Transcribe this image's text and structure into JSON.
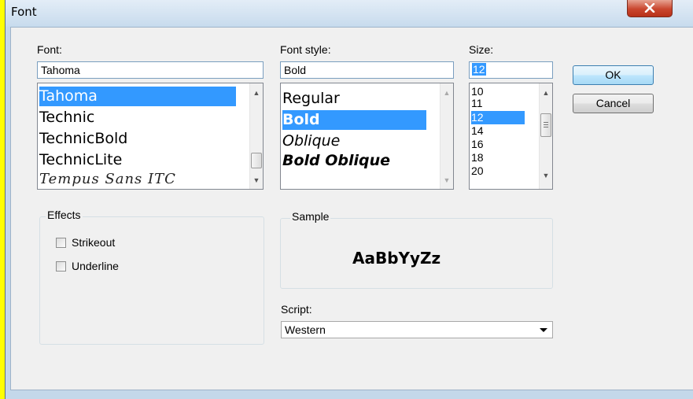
{
  "window": {
    "title": "Font"
  },
  "labels": {
    "font": "Font:",
    "font_style": "Font style:",
    "size": "Size:",
    "script": "Script:"
  },
  "inputs": {
    "font_value": "Tahoma",
    "style_value": "Bold",
    "size_value": "12"
  },
  "font_list": {
    "items": [
      "Tahoma",
      "Technic",
      "TechnicBold",
      "TechnicLite",
      "Tempus Sans ITC"
    ],
    "selected": "Tahoma"
  },
  "style_list": {
    "items": [
      "Regular",
      "Bold",
      "Oblique",
      "Bold Oblique"
    ],
    "selected": "Bold"
  },
  "size_list": {
    "items": [
      "10",
      "11",
      "12",
      "14",
      "16",
      "18",
      "20"
    ],
    "selected": "12"
  },
  "buttons": {
    "ok": "OK",
    "cancel": "Cancel"
  },
  "effects": {
    "title": "Effects",
    "strikeout": "Strikeout",
    "underline": "Underline",
    "strikeout_checked": false,
    "underline_checked": false
  },
  "sample": {
    "title": "Sample",
    "text": "AaBbYyZz"
  },
  "script": {
    "selected": "Western"
  },
  "icons": {
    "close": "close-icon",
    "scroll_up": "scroll-up-arrow-icon",
    "scroll_down": "scroll-down-arrow-icon",
    "dropdown": "chevron-down-icon"
  },
  "colors": {
    "selection": "#3399ff",
    "background": "#ffff00",
    "close_button": "#c9462e"
  }
}
